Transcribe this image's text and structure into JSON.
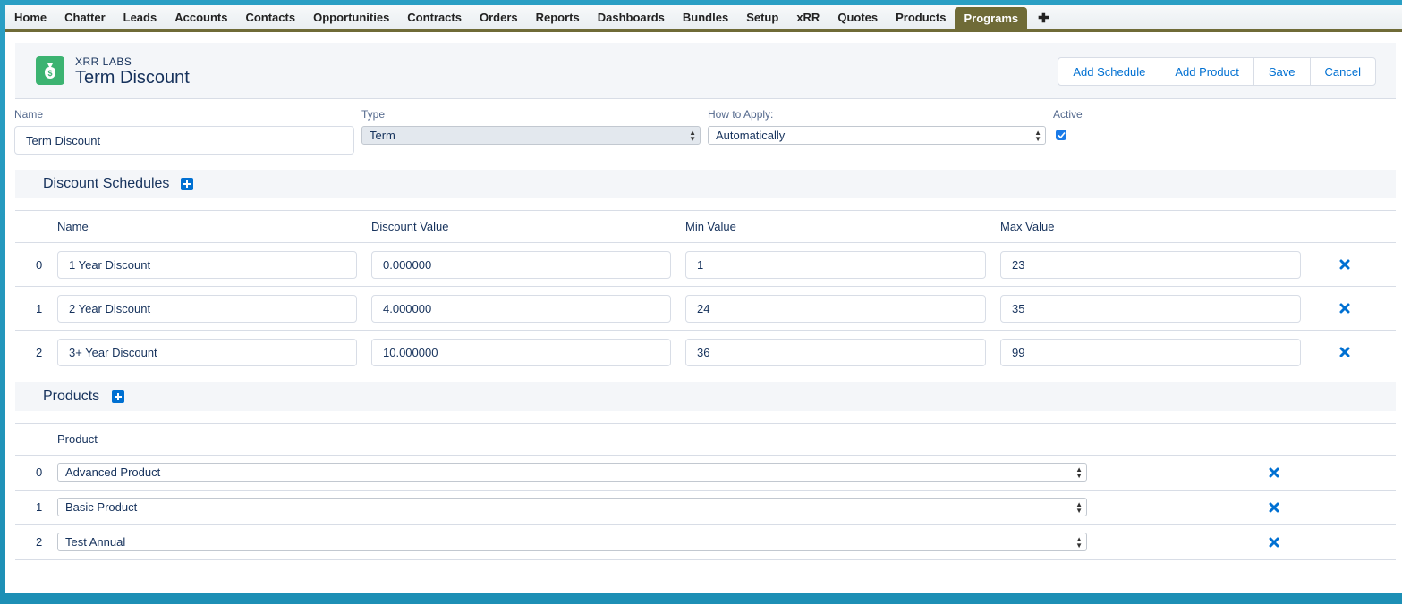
{
  "tabs": [
    "Home",
    "Chatter",
    "Leads",
    "Accounts",
    "Contacts",
    "Opportunities",
    "Contracts",
    "Orders",
    "Reports",
    "Dashboards",
    "Bundles",
    "Setup",
    "xRR",
    "Quotes",
    "Products",
    "Programs"
  ],
  "active_tab": "Programs",
  "add_tab_icon": "plus-icon",
  "header": {
    "icon": "money-bag-icon",
    "eyebrow": "XRR LABS",
    "title": "Term Discount",
    "buttons": [
      "Add Schedule",
      "Add Product",
      "Save",
      "Cancel"
    ]
  },
  "form": {
    "name_label": "Name",
    "name_value": "Term Discount",
    "type_label": "Type",
    "type_value": "Term",
    "apply_label": "How to Apply:",
    "apply_value": "Automatically",
    "active_label": "Active",
    "active_checked": true
  },
  "schedules": {
    "title": "Discount Schedules",
    "columns": [
      "Name",
      "Discount Value",
      "Min Value",
      "Max Value"
    ],
    "rows": [
      {
        "index": "0",
        "name": "1 Year Discount",
        "discount": "0.000000",
        "min": "1",
        "max": "23"
      },
      {
        "index": "1",
        "name": "2 Year Discount",
        "discount": "4.000000",
        "min": "24",
        "max": "35"
      },
      {
        "index": "2",
        "name": "3+ Year Discount",
        "discount": "10.000000",
        "min": "36",
        "max": "99"
      }
    ]
  },
  "products": {
    "title": "Products",
    "column": "Product",
    "rows": [
      {
        "index": "0",
        "product": "Advanced Product"
      },
      {
        "index": "1",
        "product": "Basic Product"
      },
      {
        "index": "2",
        "product": "Test Annual"
      }
    ]
  },
  "colors": {
    "active_tab": "#6f6b37",
    "link": "#0070d2",
    "icon_green": "#3cb371",
    "delete_blue": "#0070d2"
  }
}
